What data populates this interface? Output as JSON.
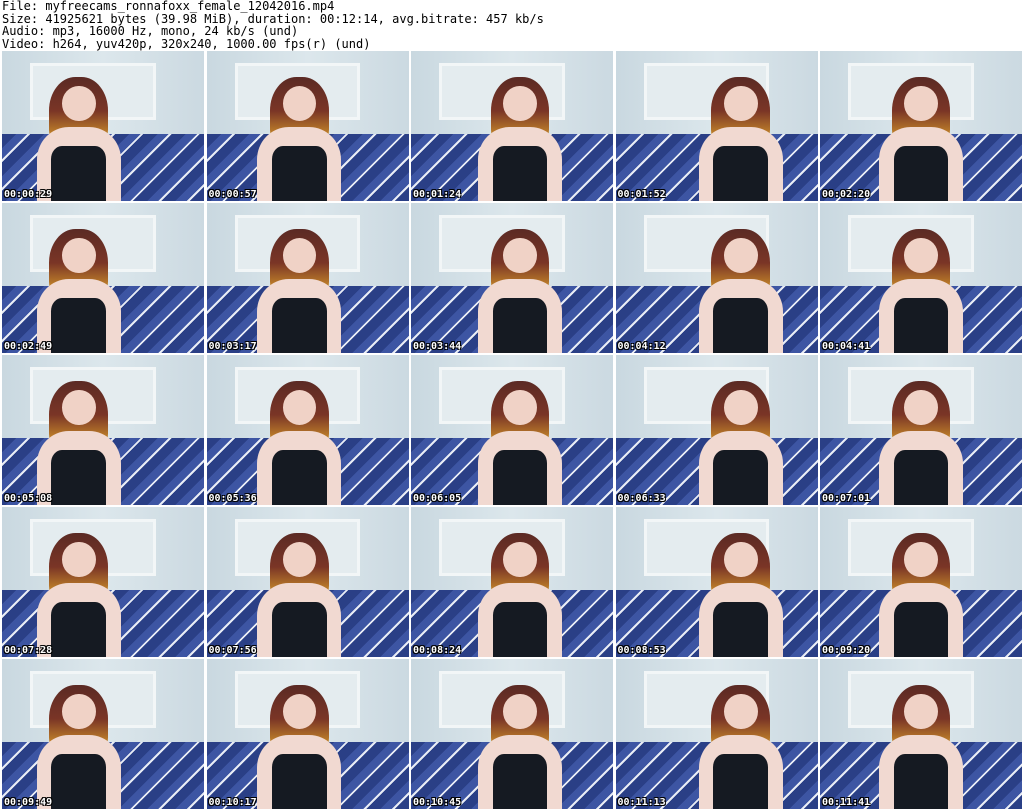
{
  "header": {
    "file": "File: myfreecams_ronnafoxx_female_12042016.mp4",
    "size": "Size: 41925621 bytes (39.98 MiB), duration: 00:12:14, avg.bitrate: 457 kb/s",
    "audio": "Audio: mp3, 16000 Hz, mono, 24 kb/s (und)",
    "video": "Video: h264, yuv420p, 320x240, 1000.00 fps(r) (und)"
  },
  "thumbnails": [
    {
      "timestamp": "00:00:29"
    },
    {
      "timestamp": "00:00:57"
    },
    {
      "timestamp": "00:01:24"
    },
    {
      "timestamp": "00:01:52"
    },
    {
      "timestamp": "00:02:20"
    },
    {
      "timestamp": "00:02:49"
    },
    {
      "timestamp": "00:03:17"
    },
    {
      "timestamp": "00:03:44"
    },
    {
      "timestamp": "00:04:12"
    },
    {
      "timestamp": "00:04:41"
    },
    {
      "timestamp": "00:05:08"
    },
    {
      "timestamp": "00:05:36"
    },
    {
      "timestamp": "00:06:05"
    },
    {
      "timestamp": "00:06:33"
    },
    {
      "timestamp": "00:07:01"
    },
    {
      "timestamp": "00:07:28"
    },
    {
      "timestamp": "00:07:56"
    },
    {
      "timestamp": "00:08:24"
    },
    {
      "timestamp": "00:08:53"
    },
    {
      "timestamp": "00:09:20"
    },
    {
      "timestamp": "00:09:49"
    },
    {
      "timestamp": "00:10:17"
    },
    {
      "timestamp": "00:10:45"
    },
    {
      "timestamp": "00:11:13"
    },
    {
      "timestamp": "00:11:41"
    }
  ]
}
